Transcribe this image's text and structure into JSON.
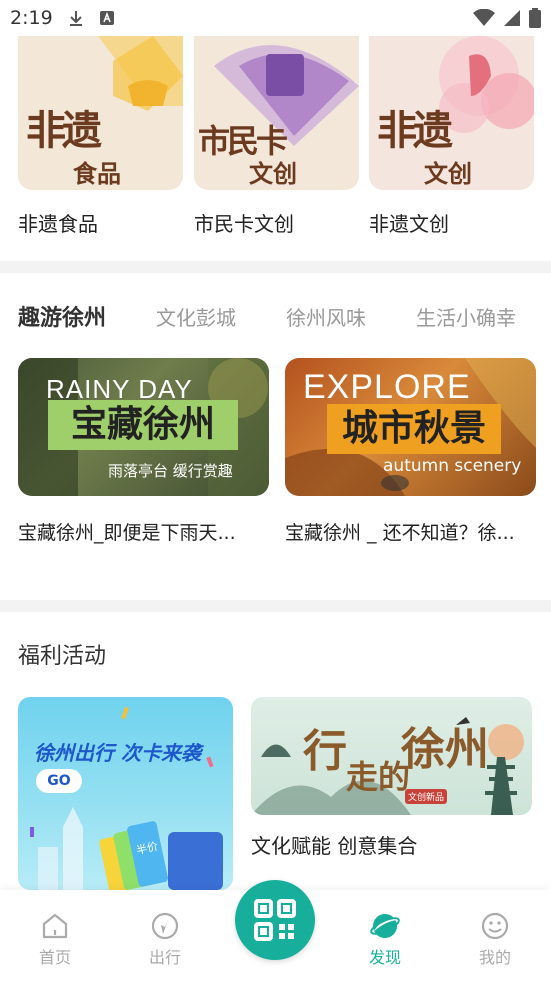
{
  "status_bar": {
    "time": "2:19"
  },
  "categories": [
    {
      "label": "非遗食品",
      "art_big": "非遗",
      "art_small": "食品",
      "bg": "#f3e7d8",
      "accent": "#f7cf5e"
    },
    {
      "label": "市民卡文创",
      "art_big": "市民卡",
      "art_small": "文创",
      "bg": "#f3e7da",
      "accent": "#a77bc4"
    },
    {
      "label": "非遗文创",
      "art_big": "非遗",
      "art_small": "文创",
      "bg": "#f4e6de",
      "accent": "#f3a7b4"
    }
  ],
  "tabs": [
    {
      "label": "趣游徐州",
      "active": true
    },
    {
      "label": "文化彭城",
      "active": false
    },
    {
      "label": "徐州风味",
      "active": false
    },
    {
      "label": "生活小确幸",
      "active": false
    }
  ],
  "videos": [
    {
      "title": "宝藏徐州_即便是下雨天...",
      "overlay_en": "RAINY DAY",
      "overlay_cn": "宝藏徐州",
      "overlay_sub": "雨落亭台 缓行赏趣",
      "box_color": "#9fcf6a"
    },
    {
      "title": "宝藏徐州 _ 还不知道？徐...",
      "overlay_en": "EXPLORE",
      "overlay_cn": "城市秋景",
      "overlay_sub": "autumn scenery",
      "box_color": "#f0a020"
    }
  ],
  "welfare": {
    "section_title": "福利活动",
    "promo_left": {
      "headline": "徐州出行 次卡来袭",
      "button": "GO",
      "card_text": "半价"
    },
    "promo_right": {
      "art_text_1": "行",
      "art_text_2": "走的",
      "art_text_3": "徐州",
      "stamp": "文创新品",
      "title": "文化赋能 创意集合"
    }
  },
  "bottom_nav": [
    {
      "label": "首页",
      "icon": "home-icon",
      "active": false
    },
    {
      "label": "出行",
      "icon": "travel-icon",
      "active": false
    },
    {
      "label": "发现",
      "icon": "discover-icon",
      "active": true
    },
    {
      "label": "我的",
      "icon": "smile-icon",
      "active": false
    }
  ],
  "colors": {
    "accent": "#17ae9b",
    "inactive": "#aaaaaa"
  }
}
